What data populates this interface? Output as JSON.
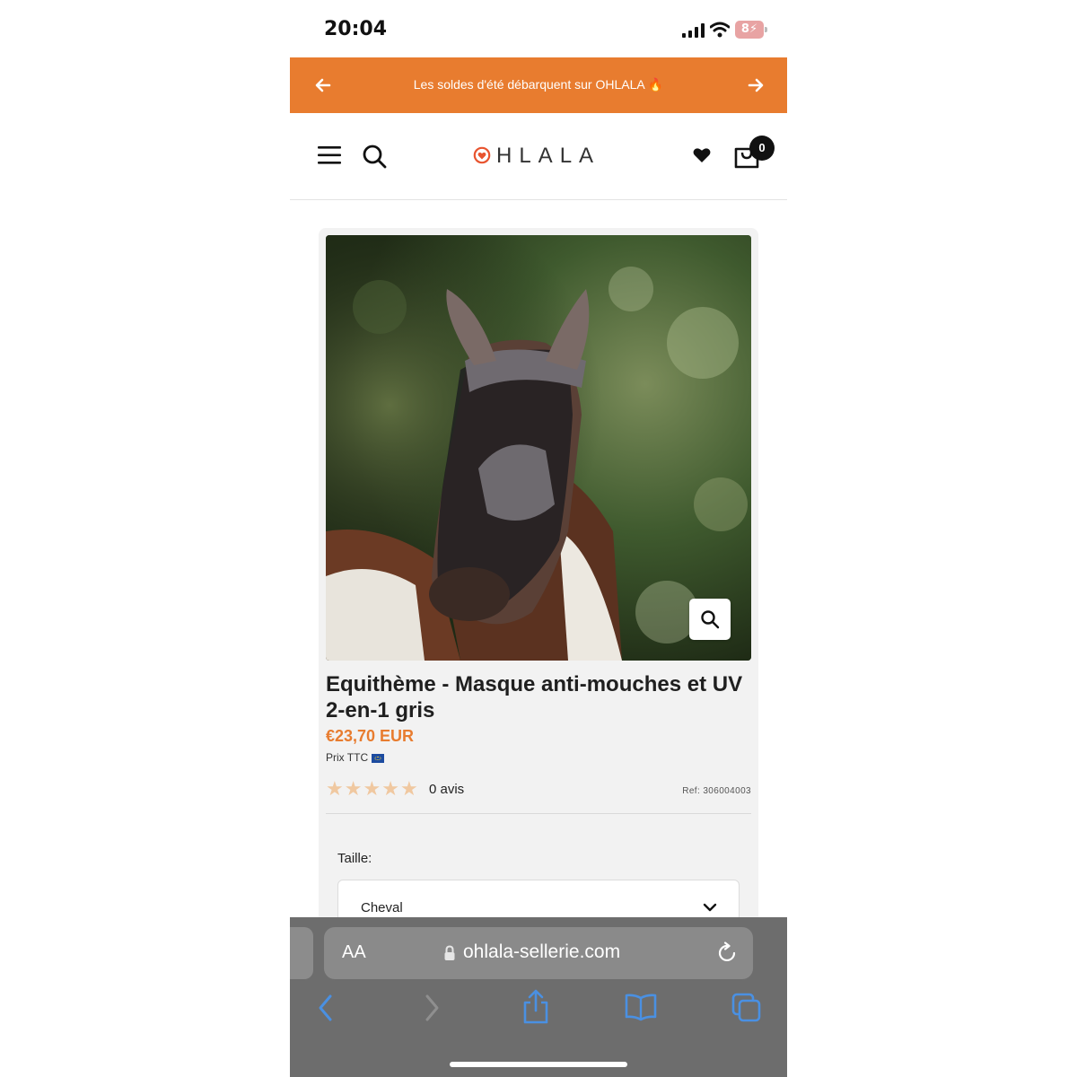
{
  "status_bar": {
    "time": "20:04",
    "battery": "8"
  },
  "promo": {
    "text": "Les soldes d'été débarquent sur OHLALA 🔥"
  },
  "header": {
    "logo_text": "HLALA",
    "cart_count": "0"
  },
  "product": {
    "title": "Equithème - Masque anti-mouches et UV 2-en-1 gris",
    "price": "€23,70 EUR",
    "tax_note": "Prix TTC",
    "rating_stars": 0,
    "max_stars": 5,
    "review_count": "0 avis",
    "ref": "Ref: 306004003",
    "size_label": "Taille:",
    "size_value": "Cheval"
  },
  "browser": {
    "aa_label": "AA",
    "url": "ohlala-sellerie.com"
  },
  "colors": {
    "brand_orange": "#e87c2f",
    "toolbar_gray": "#6d6d6d",
    "ios_blue": "#4a90e2"
  }
}
